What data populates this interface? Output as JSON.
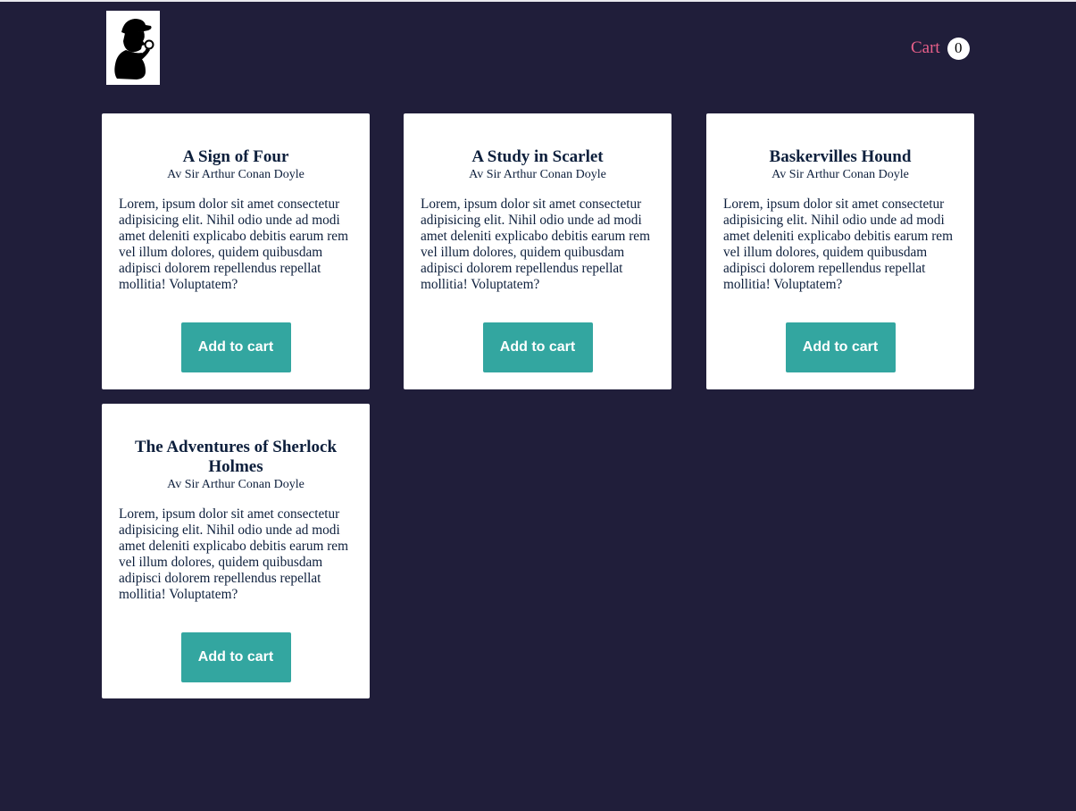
{
  "header": {
    "cart_label": "Cart",
    "cart_count": "0"
  },
  "colors": {
    "background": "#201e3a",
    "cart_accent": "#e9608a",
    "button": "#33a6a0",
    "text": "#0d1f3c"
  },
  "books": [
    {
      "title": "A Sign of Four",
      "author": "Av Sir Arthur Conan Doyle",
      "description": "Lorem, ipsum dolor sit amet consectetur adipisicing elit. Nihil odio unde ad modi amet deleniti explicabo debitis earum rem vel illum dolores, quidem quibusdam adipisci dolorem repellendus repellat mollitia! Voluptatem?",
      "button_label": "Add to cart"
    },
    {
      "title": "A Study in Scarlet",
      "author": "Av Sir Arthur Conan Doyle",
      "description": "Lorem, ipsum dolor sit amet consectetur adipisicing elit. Nihil odio unde ad modi amet deleniti explicabo debitis earum rem vel illum dolores, quidem quibusdam adipisci dolorem repellendus repellat mollitia! Voluptatem?",
      "button_label": "Add to cart"
    },
    {
      "title": "Baskervilles Hound",
      "author": "Av Sir Arthur Conan Doyle",
      "description": "Lorem, ipsum dolor sit amet consectetur adipisicing elit. Nihil odio unde ad modi amet deleniti explicabo debitis earum rem vel illum dolores, quidem quibusdam adipisci dolorem repellendus repellat mollitia! Voluptatem?",
      "button_label": "Add to cart"
    },
    {
      "title": "The Adventures of Sherlock Holmes",
      "author": "Av Sir Arthur Conan Doyle",
      "description": "Lorem, ipsum dolor sit amet consectetur adipisicing elit. Nihil odio unde ad modi amet deleniti explicabo debitis earum rem vel illum dolores, quidem quibusdam adipisci dolorem repellendus repellat mollitia! Voluptatem?",
      "button_label": "Add to cart"
    }
  ]
}
